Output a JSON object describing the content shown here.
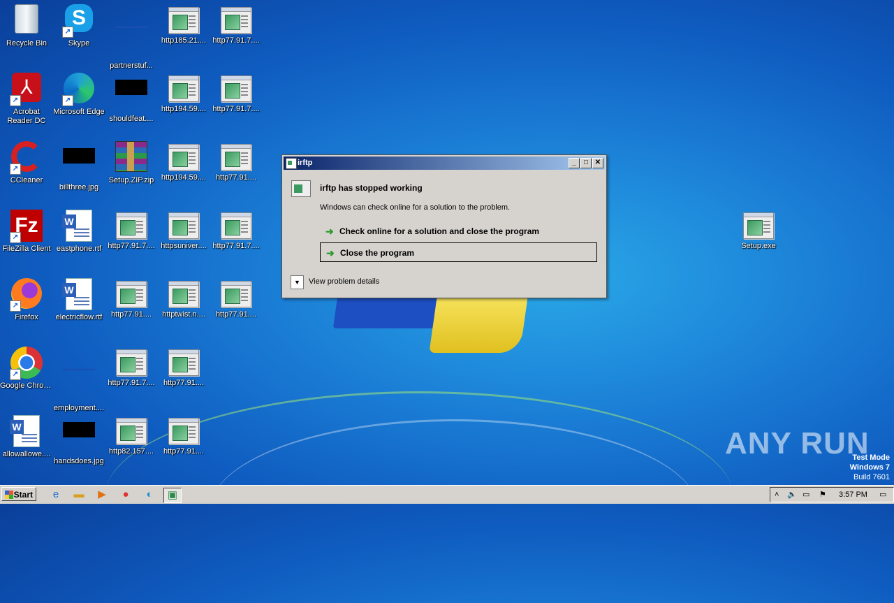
{
  "desktop_icons": [
    {
      "label": "Recycle Bin",
      "kind": "recycle-bin"
    },
    {
      "label": "Skype",
      "kind": "skype"
    },
    {
      "label": "partnerstuf...",
      "kind": "blank"
    },
    {
      "label": "http185.21....",
      "kind": "exe"
    },
    {
      "label": "http77.91.7....",
      "kind": "exe"
    },
    {
      "label": "Acrobat Reader DC",
      "kind": "acrobat"
    },
    {
      "label": "Microsoft Edge",
      "kind": "edge"
    },
    {
      "label": "shouldfeat....",
      "kind": "black-img"
    },
    {
      "label": "http194.59....",
      "kind": "exe"
    },
    {
      "label": "http77.91.7....",
      "kind": "exe"
    },
    {
      "label": "CCleaner",
      "kind": "ccleaner"
    },
    {
      "label": "billthree.jpg",
      "kind": "black-img"
    },
    {
      "label": "Setup.ZIP.zip",
      "kind": "winrar"
    },
    {
      "label": "http194.59....",
      "kind": "exe"
    },
    {
      "label": "http77.91....",
      "kind": "exe"
    },
    {
      "label": "FileZilla Client",
      "kind": "filezilla"
    },
    {
      "label": "eastphone.rtf",
      "kind": "word"
    },
    {
      "label": "http77.91.7....",
      "kind": "exe"
    },
    {
      "label": "httpsuniver....",
      "kind": "exe"
    },
    {
      "label": "http77.91.7....",
      "kind": "exe"
    },
    {
      "label": "Firefox",
      "kind": "firefox"
    },
    {
      "label": "electricflow.rtf",
      "kind": "word"
    },
    {
      "label": "http77.91....",
      "kind": "exe"
    },
    {
      "label": "httptwist.n....",
      "kind": "exe"
    },
    {
      "label": "http77.91....",
      "kind": "exe"
    },
    {
      "label": "Google Chrome",
      "kind": "chrome"
    },
    {
      "label": "employment....",
      "kind": "blank"
    },
    {
      "label": "http77.91.7....",
      "kind": "exe"
    },
    {
      "label": "http77.91....",
      "kind": "exe"
    },
    {
      "label": "allowallowe....",
      "kind": "word"
    },
    {
      "label": "handsdoes.jpg",
      "kind": "black-img"
    },
    {
      "label": "http82.157....",
      "kind": "exe"
    },
    {
      "label": "http77.91....",
      "kind": "exe"
    },
    {
      "label": "Setup.exe",
      "kind": "exe"
    }
  ],
  "dialog": {
    "title": "irftp",
    "heading": "irftp has stopped working",
    "subtext": "Windows can check online for a solution to the problem.",
    "option_check_online": "Check online for a solution and close the program",
    "option_close": "Close the program",
    "details_label": "View problem details",
    "minimize": "_",
    "maximize": "□",
    "close": "✕"
  },
  "taskbar": {
    "start_label": "Start",
    "clock": "3:57 PM"
  },
  "watermark": {
    "brand": "ANY RUN",
    "test_mode": "Test Mode",
    "os": "Windows 7",
    "build": "Build 7601"
  }
}
